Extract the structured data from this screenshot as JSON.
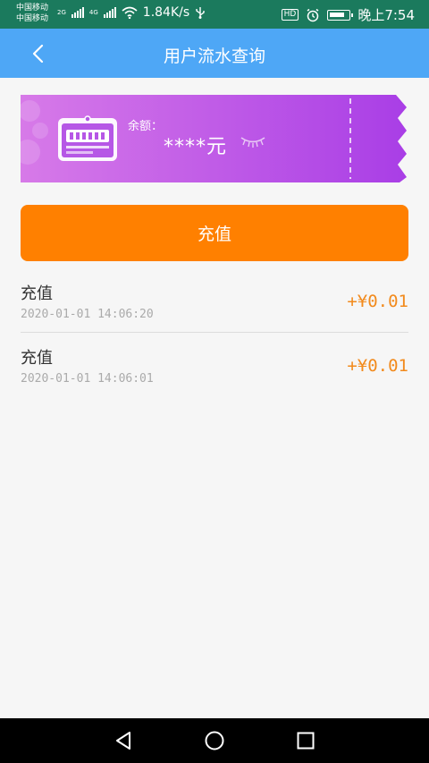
{
  "status_bar": {
    "carrier_1": "中国移动",
    "carrier_2": "中国移动",
    "net_1": "2G",
    "net_2": "4G",
    "speed": "1.84K/s",
    "hd_badge": "HD",
    "time": "晚上7:54"
  },
  "app_bar": {
    "title": "用户流水查询",
    "back_icon": "chevron-left-icon"
  },
  "balance_card": {
    "label": "余额：",
    "value": "****元",
    "eye_icon": "eye-closed-icon",
    "gradient": [
      "#d77ae8",
      "#a93ee6"
    ]
  },
  "recharge_button": {
    "label": "充值",
    "color": "#ff8000"
  },
  "transactions": [
    {
      "type": "充值",
      "time": "2020-01-01 14:06:20",
      "amount": "+¥0.01"
    },
    {
      "type": "充值",
      "time": "2020-01-01 14:06:01",
      "amount": "+¥0.01"
    }
  ],
  "colors": {
    "status_bar": "#1b7a5d",
    "app_bar": "#4ea7f6",
    "amount": "#f28a1c"
  }
}
